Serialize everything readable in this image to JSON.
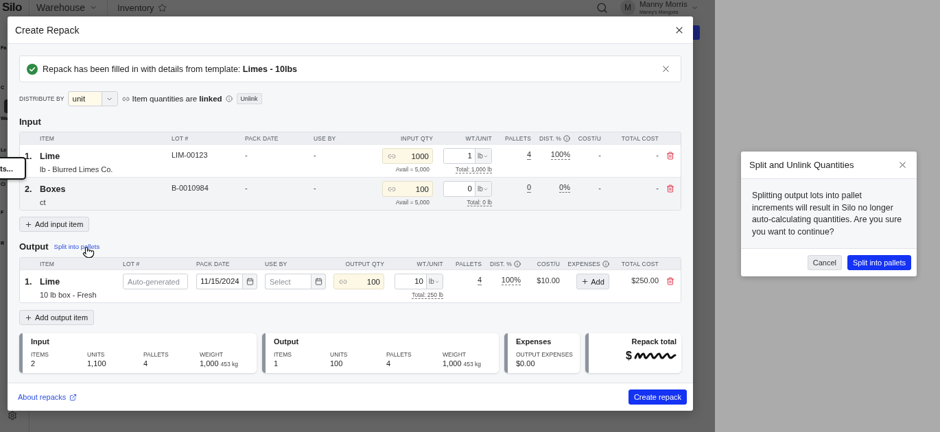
{
  "app_bar": {
    "logo": "Silo",
    "workspace": "Warehouse",
    "page": "Inventory",
    "user": {
      "initial": "M",
      "name": "Manny Morris",
      "company": "Manny's Mangoes"
    }
  },
  "sidebar": {
    "items": [
      {
        "kind": "label",
        "label": "Fa"
      },
      {
        "kind": "label",
        "label": "C"
      },
      {
        "kind": "tile",
        "label": "Wa"
      },
      {
        "kind": "label",
        "label": "Le"
      },
      {
        "kind": "label",
        "label": "Ci"
      },
      {
        "kind": "label",
        "label": "F"
      },
      {
        "kind": "label",
        "label": "R"
      }
    ],
    "tooltip": "ts..."
  },
  "repack_modal": {
    "title": "Create Repack",
    "banner": {
      "message": "Repack has been filled in with details from template: **Limes - 10lbs**"
    },
    "distribute": {
      "label": "DISTRIBUTE BY",
      "value": "unit",
      "link_status": "Item quantities are **linked**",
      "unlink_button": "Unlink"
    },
    "input": {
      "heading": "Input",
      "columns": [
        {
          "label": "ITEM",
          "info": false
        },
        {
          "label": "LOT #",
          "info": false
        },
        {
          "label": "PACK DATE",
          "info": false
        },
        {
          "label": "USE BY",
          "info": false
        },
        {
          "label": "INPUT QTY",
          "info": false
        },
        {
          "label": "WT./UNIT",
          "info": false
        },
        {
          "label": "PALLETS",
          "info": false
        },
        {
          "label": "DIST. %",
          "info": true
        },
        {
          "label": "COST/U",
          "info": false
        },
        {
          "label": "TOTAL COST",
          "info": false
        }
      ],
      "rows": [
        {
          "number": "1.",
          "name": "Lime",
          "detail": "lb - Blurred Limes Co.",
          "lot": "LIM-00123",
          "pack_date": "-",
          "use_by": "-",
          "qty": "1000",
          "avail": "Avail = 5,000",
          "weight": "1",
          "unit": "lb",
          "total_weight": "Total: 1,000 lb",
          "pallets": "4",
          "dist": "100%",
          "cost": "-",
          "total_cost": "-"
        },
        {
          "number": "2.",
          "name": "Boxes",
          "detail": "ct",
          "lot": "B-0010984",
          "pack_date": "-",
          "use_by": "-",
          "qty": "100",
          "avail": "Avail = 5,000",
          "weight": "0",
          "unit": "lb",
          "total_weight": "Total: 0 lb",
          "pallets": "0",
          "dist": "0%",
          "cost": "-",
          "total_cost": "-"
        }
      ],
      "add_button": "Add input item"
    },
    "output": {
      "heading": "Output",
      "split_link": "Split into pallets",
      "columns": [
        {
          "label": "ITEM",
          "info": false
        },
        {
          "label": "LOT #",
          "info": false
        },
        {
          "label": "PACK DATE",
          "info": false
        },
        {
          "label": "USE BY",
          "info": false
        },
        {
          "label": "OUTPUT QTY",
          "info": false
        },
        {
          "label": "WT./UNIT",
          "info": false
        },
        {
          "label": "PALLETS",
          "info": false
        },
        {
          "label": "DIST. %",
          "info": true
        },
        {
          "label": "COST/U",
          "info": false
        },
        {
          "label": "EXPENSES",
          "info": true
        },
        {
          "label": "TOTAL COST",
          "info": false
        }
      ],
      "rows": [
        {
          "number": "1.",
          "name": "Lime",
          "detail": "10 lb box - Fresh",
          "lot": {
            "placeholder": "Auto-generated"
          },
          "pack_date": "11/15/2024",
          "use_by": {
            "placeholder": "Select"
          },
          "qty": "100",
          "weight": "10",
          "unit": "lb",
          "total_weight": "Total: 250 lb",
          "pallets": "4",
          "dist": "100%",
          "cost": "$10.00",
          "expenses_button": "Add",
          "total_cost": "$250.00"
        }
      ],
      "add_button": "Add output item"
    },
    "summary": [
      {
        "kind": "stats",
        "title": "Input",
        "stats": [
          {
            "label": "ITEMS",
            "value": "2"
          },
          {
            "label": "UNITS",
            "value": "1,100"
          },
          {
            "label": "PALLETS",
            "value": "4"
          },
          {
            "label": "WEIGHT",
            "value": "1,000",
            "secondary": "453 kg"
          }
        ]
      },
      {
        "kind": "stats",
        "title": "Output",
        "stats": [
          {
            "label": "ITEMS",
            "value": "1"
          },
          {
            "label": "UNITS",
            "value": "100"
          },
          {
            "label": "PALLETS",
            "value": "4"
          },
          {
            "label": "WEIGHT",
            "value": "1,000",
            "secondary": "453 kg"
          }
        ]
      },
      {
        "kind": "stats",
        "title": "Expenses",
        "stats": [
          {
            "label": "OUTPUT EXPENSES",
            "value": "$0.00"
          }
        ]
      },
      {
        "kind": "total",
        "title": "Repack total",
        "currency": "$"
      }
    ],
    "footer": {
      "help_link": "About repacks",
      "submit_button": "Create repack"
    }
  },
  "confirm_dialog": {
    "title": "Split and Unlink Quantities",
    "message": "Splitting output lots into pallet increments will result in Silo no longer auto-calculating quantities. Are you sure you want to continue?",
    "buttons": [
      {
        "kind": "secondary",
        "label": "Cancel"
      },
      {
        "kind": "primary",
        "label": "Split into pallets"
      }
    ]
  }
}
